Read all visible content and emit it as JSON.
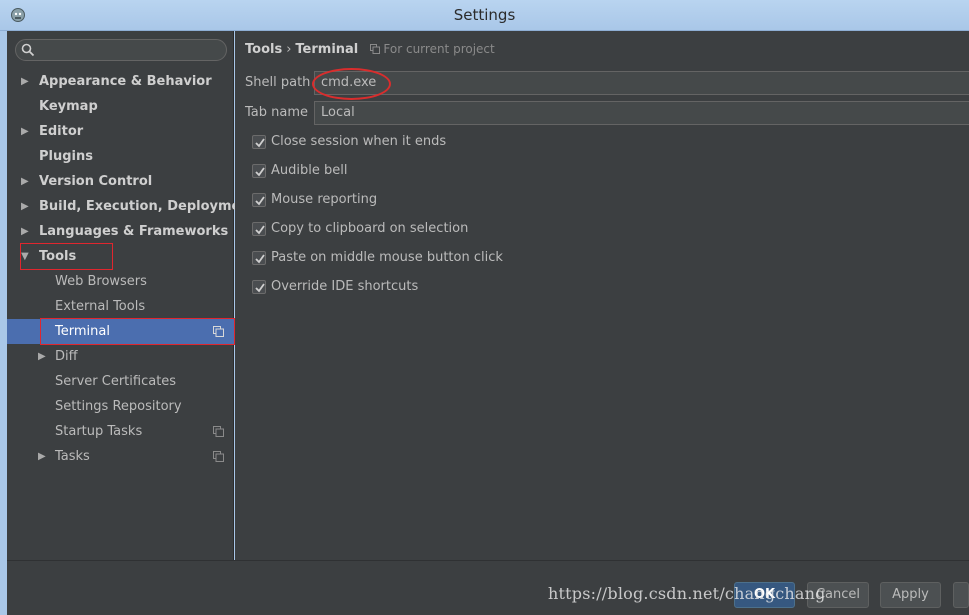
{
  "window": {
    "title": "Settings",
    "icon": "android-icon"
  },
  "search": {
    "placeholder": "",
    "icon": "search-icon"
  },
  "tree": {
    "items": [
      {
        "label": "Appearance & Behavior",
        "bold": true,
        "expandable": true
      },
      {
        "label": "Keymap",
        "bold": true,
        "expandable": false
      },
      {
        "label": "Editor",
        "bold": true,
        "expandable": true
      },
      {
        "label": "Plugins",
        "bold": true,
        "expandable": false
      },
      {
        "label": "Version Control",
        "bold": true,
        "expandable": true
      },
      {
        "label": "Build, Execution, Deployment",
        "bold": true,
        "expandable": true
      },
      {
        "label": "Languages & Frameworks",
        "bold": true,
        "expandable": true
      },
      {
        "label": "Tools",
        "bold": true,
        "expanded": true
      },
      {
        "label": "Web Browsers"
      },
      {
        "label": "External Tools"
      },
      {
        "label": "Terminal",
        "selected": true,
        "project_icon": true
      },
      {
        "label": "Diff",
        "expandable": true
      },
      {
        "label": "Server Certificates"
      },
      {
        "label": "Settings Repository"
      },
      {
        "label": "Startup Tasks",
        "project_icon": true
      },
      {
        "label": "Tasks",
        "expandable": true,
        "project_icon": true
      }
    ]
  },
  "breadcrumb": {
    "parent": "Tools",
    "separator": "›",
    "current": "Terminal",
    "scope": "For current project"
  },
  "fields": {
    "shell_path": {
      "label": "Shell path",
      "value": "cmd.exe"
    },
    "tab_name": {
      "label": "Tab name",
      "value": "Local"
    }
  },
  "checkboxes": [
    {
      "label": "Close session when it ends",
      "checked": true
    },
    {
      "label": "Audible bell",
      "checked": true
    },
    {
      "label": "Mouse reporting",
      "checked": true
    },
    {
      "label": "Copy to clipboard on selection",
      "checked": true
    },
    {
      "label": "Paste on middle mouse button click",
      "checked": true
    },
    {
      "label": "Override IDE shortcuts",
      "checked": true
    }
  ],
  "buttons": {
    "ok": "OK",
    "cancel": "Cancel",
    "apply": "Apply"
  },
  "watermark": "https://blog.csdn.net/changchang",
  "colors": {
    "selection": "#4b6eaf",
    "highlight_red": "#e0262e",
    "background": "#3c3f41"
  }
}
